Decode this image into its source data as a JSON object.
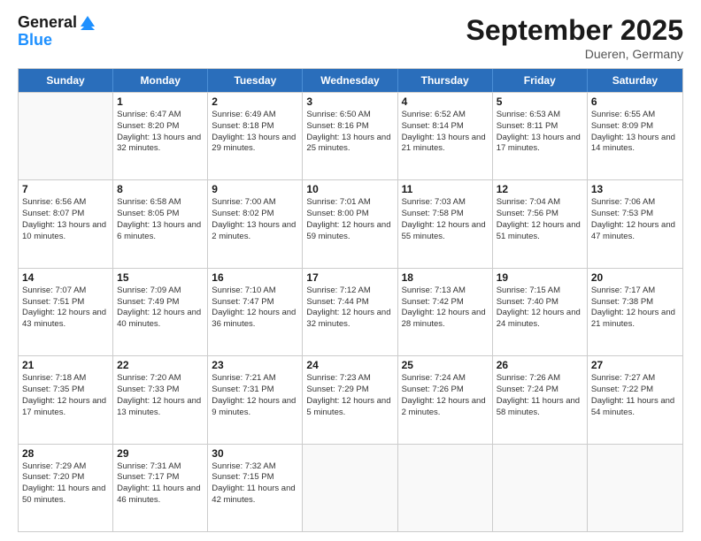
{
  "header": {
    "logo_line1": "General",
    "logo_line2": "Blue",
    "month_title": "September 2025",
    "location": "Dueren, Germany"
  },
  "days_of_week": [
    "Sunday",
    "Monday",
    "Tuesday",
    "Wednesday",
    "Thursday",
    "Friday",
    "Saturday"
  ],
  "weeks": [
    [
      {
        "day": "",
        "sunrise": "",
        "sunset": "",
        "daylight": "",
        "empty": true
      },
      {
        "day": "1",
        "sunrise": "6:47 AM",
        "sunset": "8:20 PM",
        "daylight": "13 hours and 32 minutes."
      },
      {
        "day": "2",
        "sunrise": "6:49 AM",
        "sunset": "8:18 PM",
        "daylight": "13 hours and 29 minutes."
      },
      {
        "day": "3",
        "sunrise": "6:50 AM",
        "sunset": "8:16 PM",
        "daylight": "13 hours and 25 minutes."
      },
      {
        "day": "4",
        "sunrise": "6:52 AM",
        "sunset": "8:14 PM",
        "daylight": "13 hours and 21 minutes."
      },
      {
        "day": "5",
        "sunrise": "6:53 AM",
        "sunset": "8:11 PM",
        "daylight": "13 hours and 17 minutes."
      },
      {
        "day": "6",
        "sunrise": "6:55 AM",
        "sunset": "8:09 PM",
        "daylight": "13 hours and 14 minutes."
      }
    ],
    [
      {
        "day": "7",
        "sunrise": "6:56 AM",
        "sunset": "8:07 PM",
        "daylight": "13 hours and 10 minutes."
      },
      {
        "day": "8",
        "sunrise": "6:58 AM",
        "sunset": "8:05 PM",
        "daylight": "13 hours and 6 minutes."
      },
      {
        "day": "9",
        "sunrise": "7:00 AM",
        "sunset": "8:02 PM",
        "daylight": "13 hours and 2 minutes."
      },
      {
        "day": "10",
        "sunrise": "7:01 AM",
        "sunset": "8:00 PM",
        "daylight": "12 hours and 59 minutes."
      },
      {
        "day": "11",
        "sunrise": "7:03 AM",
        "sunset": "7:58 PM",
        "daylight": "12 hours and 55 minutes."
      },
      {
        "day": "12",
        "sunrise": "7:04 AM",
        "sunset": "7:56 PM",
        "daylight": "12 hours and 51 minutes."
      },
      {
        "day": "13",
        "sunrise": "7:06 AM",
        "sunset": "7:53 PM",
        "daylight": "12 hours and 47 minutes."
      }
    ],
    [
      {
        "day": "14",
        "sunrise": "7:07 AM",
        "sunset": "7:51 PM",
        "daylight": "12 hours and 43 minutes."
      },
      {
        "day": "15",
        "sunrise": "7:09 AM",
        "sunset": "7:49 PM",
        "daylight": "12 hours and 40 minutes."
      },
      {
        "day": "16",
        "sunrise": "7:10 AM",
        "sunset": "7:47 PM",
        "daylight": "12 hours and 36 minutes."
      },
      {
        "day": "17",
        "sunrise": "7:12 AM",
        "sunset": "7:44 PM",
        "daylight": "12 hours and 32 minutes."
      },
      {
        "day": "18",
        "sunrise": "7:13 AM",
        "sunset": "7:42 PM",
        "daylight": "12 hours and 28 minutes."
      },
      {
        "day": "19",
        "sunrise": "7:15 AM",
        "sunset": "7:40 PM",
        "daylight": "12 hours and 24 minutes."
      },
      {
        "day": "20",
        "sunrise": "7:17 AM",
        "sunset": "7:38 PM",
        "daylight": "12 hours and 21 minutes."
      }
    ],
    [
      {
        "day": "21",
        "sunrise": "7:18 AM",
        "sunset": "7:35 PM",
        "daylight": "12 hours and 17 minutes."
      },
      {
        "day": "22",
        "sunrise": "7:20 AM",
        "sunset": "7:33 PM",
        "daylight": "12 hours and 13 minutes."
      },
      {
        "day": "23",
        "sunrise": "7:21 AM",
        "sunset": "7:31 PM",
        "daylight": "12 hours and 9 minutes."
      },
      {
        "day": "24",
        "sunrise": "7:23 AM",
        "sunset": "7:29 PM",
        "daylight": "12 hours and 5 minutes."
      },
      {
        "day": "25",
        "sunrise": "7:24 AM",
        "sunset": "7:26 PM",
        "daylight": "12 hours and 2 minutes."
      },
      {
        "day": "26",
        "sunrise": "7:26 AM",
        "sunset": "7:24 PM",
        "daylight": "11 hours and 58 minutes."
      },
      {
        "day": "27",
        "sunrise": "7:27 AM",
        "sunset": "7:22 PM",
        "daylight": "11 hours and 54 minutes."
      }
    ],
    [
      {
        "day": "28",
        "sunrise": "7:29 AM",
        "sunset": "7:20 PM",
        "daylight": "11 hours and 50 minutes."
      },
      {
        "day": "29",
        "sunrise": "7:31 AM",
        "sunset": "7:17 PM",
        "daylight": "11 hours and 46 minutes."
      },
      {
        "day": "30",
        "sunrise": "7:32 AM",
        "sunset": "7:15 PM",
        "daylight": "11 hours and 42 minutes."
      },
      {
        "day": "",
        "sunrise": "",
        "sunset": "",
        "daylight": "",
        "empty": true
      },
      {
        "day": "",
        "sunrise": "",
        "sunset": "",
        "daylight": "",
        "empty": true
      },
      {
        "day": "",
        "sunrise": "",
        "sunset": "",
        "daylight": "",
        "empty": true
      },
      {
        "day": "",
        "sunrise": "",
        "sunset": "",
        "daylight": "",
        "empty": true
      }
    ]
  ],
  "labels": {
    "sunrise_prefix": "Sunrise: ",
    "sunset_prefix": "Sunset: ",
    "daylight_prefix": "Daylight: "
  }
}
